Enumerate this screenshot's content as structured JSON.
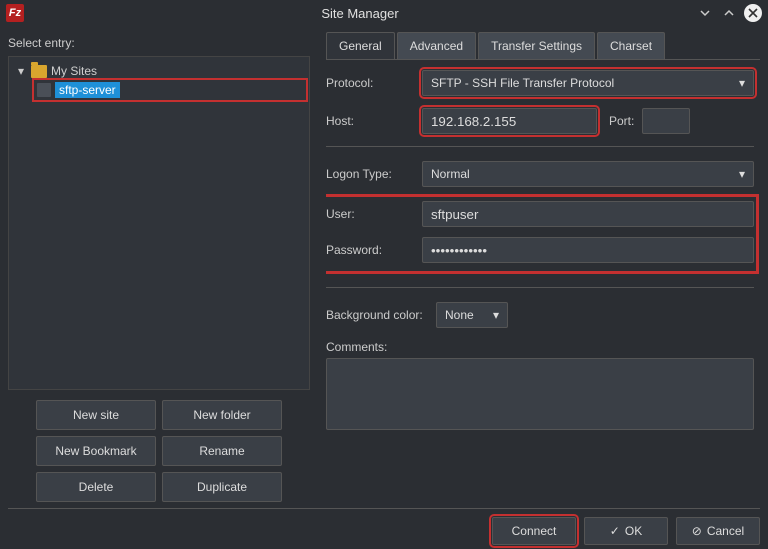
{
  "window": {
    "title": "Site Manager"
  },
  "left": {
    "select_label": "Select entry:",
    "root_label": "My Sites",
    "site_name": "sftp-server",
    "buttons": {
      "new_site": "New site",
      "new_folder": "New folder",
      "new_bookmark": "New Bookmark",
      "rename": "Rename",
      "delete": "Delete",
      "duplicate": "Duplicate"
    }
  },
  "tabs": {
    "general": "General",
    "advanced": "Advanced",
    "transfer": "Transfer Settings",
    "charset": "Charset"
  },
  "form": {
    "protocol_label": "Protocol:",
    "protocol_value": "SFTP - SSH File Transfer Protocol",
    "host_label": "Host:",
    "host_value": "192.168.2.155",
    "port_label": "Port:",
    "port_value": "",
    "logon_label": "Logon Type:",
    "logon_value": "Normal",
    "user_label": "User:",
    "user_value": "sftpuser",
    "password_label": "Password:",
    "password_value": "••••••••••••",
    "bgcolor_label": "Background color:",
    "bgcolor_value": "None",
    "comments_label": "Comments:",
    "comments_value": ""
  },
  "footer": {
    "connect": "Connect",
    "ok": "OK",
    "cancel": "Cancel"
  }
}
